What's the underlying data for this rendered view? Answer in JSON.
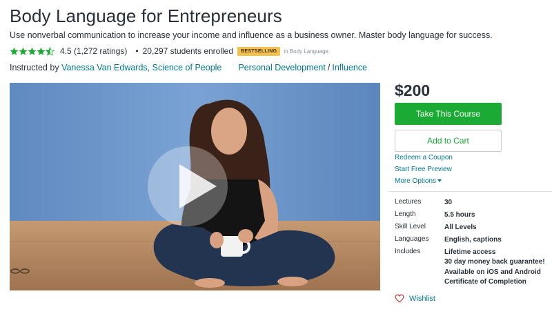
{
  "course": {
    "title": "Body Language for Entrepreneurs",
    "subtitle": "Use nonverbal communication to increase your income and influence as a business owner. Master body language for success.",
    "rating_text": "4.5 (1,272 ratings)",
    "rating_value": 4.5,
    "rating_max": 5,
    "separator": "•",
    "students": "20,297 students enrolled",
    "badge": "BESTSELLING",
    "badge_category": "in Body Language",
    "instructed_by_label": "Instructed by",
    "instructor": "Vanessa Van Edwards, Science of People",
    "category_primary": "Personal Development",
    "category_sep": "/",
    "category_secondary": "Influence"
  },
  "sidebar": {
    "price": "$200",
    "take_course": "Take This Course",
    "add_to_cart": "Add to Cart",
    "redeem_coupon": "Redeem a Coupon",
    "free_preview": "Start Free Preview",
    "more_options": "More Options",
    "details": [
      {
        "label": "Lectures",
        "value": "30"
      },
      {
        "label": "Length",
        "value": "5.5 hours"
      },
      {
        "label": "Skill Level",
        "value": "All Levels"
      },
      {
        "label": "Languages",
        "value": "English, captions"
      }
    ],
    "includes_label": "Includes",
    "includes": [
      "Lifetime access",
      "30 day money back guarantee!",
      "Available on iOS and Android",
      "Certificate of Completion"
    ],
    "wishlist": "Wishlist"
  },
  "colors": {
    "green": "#1bab35",
    "link": "#007791",
    "star": "#1bab35",
    "badge": "#f4c150",
    "wall": "#6d96c8",
    "floor": "#b58a63"
  },
  "icons": {
    "star": "star-icon",
    "play": "play-icon",
    "heart": "heart-icon",
    "caret": "caret-down-icon"
  }
}
